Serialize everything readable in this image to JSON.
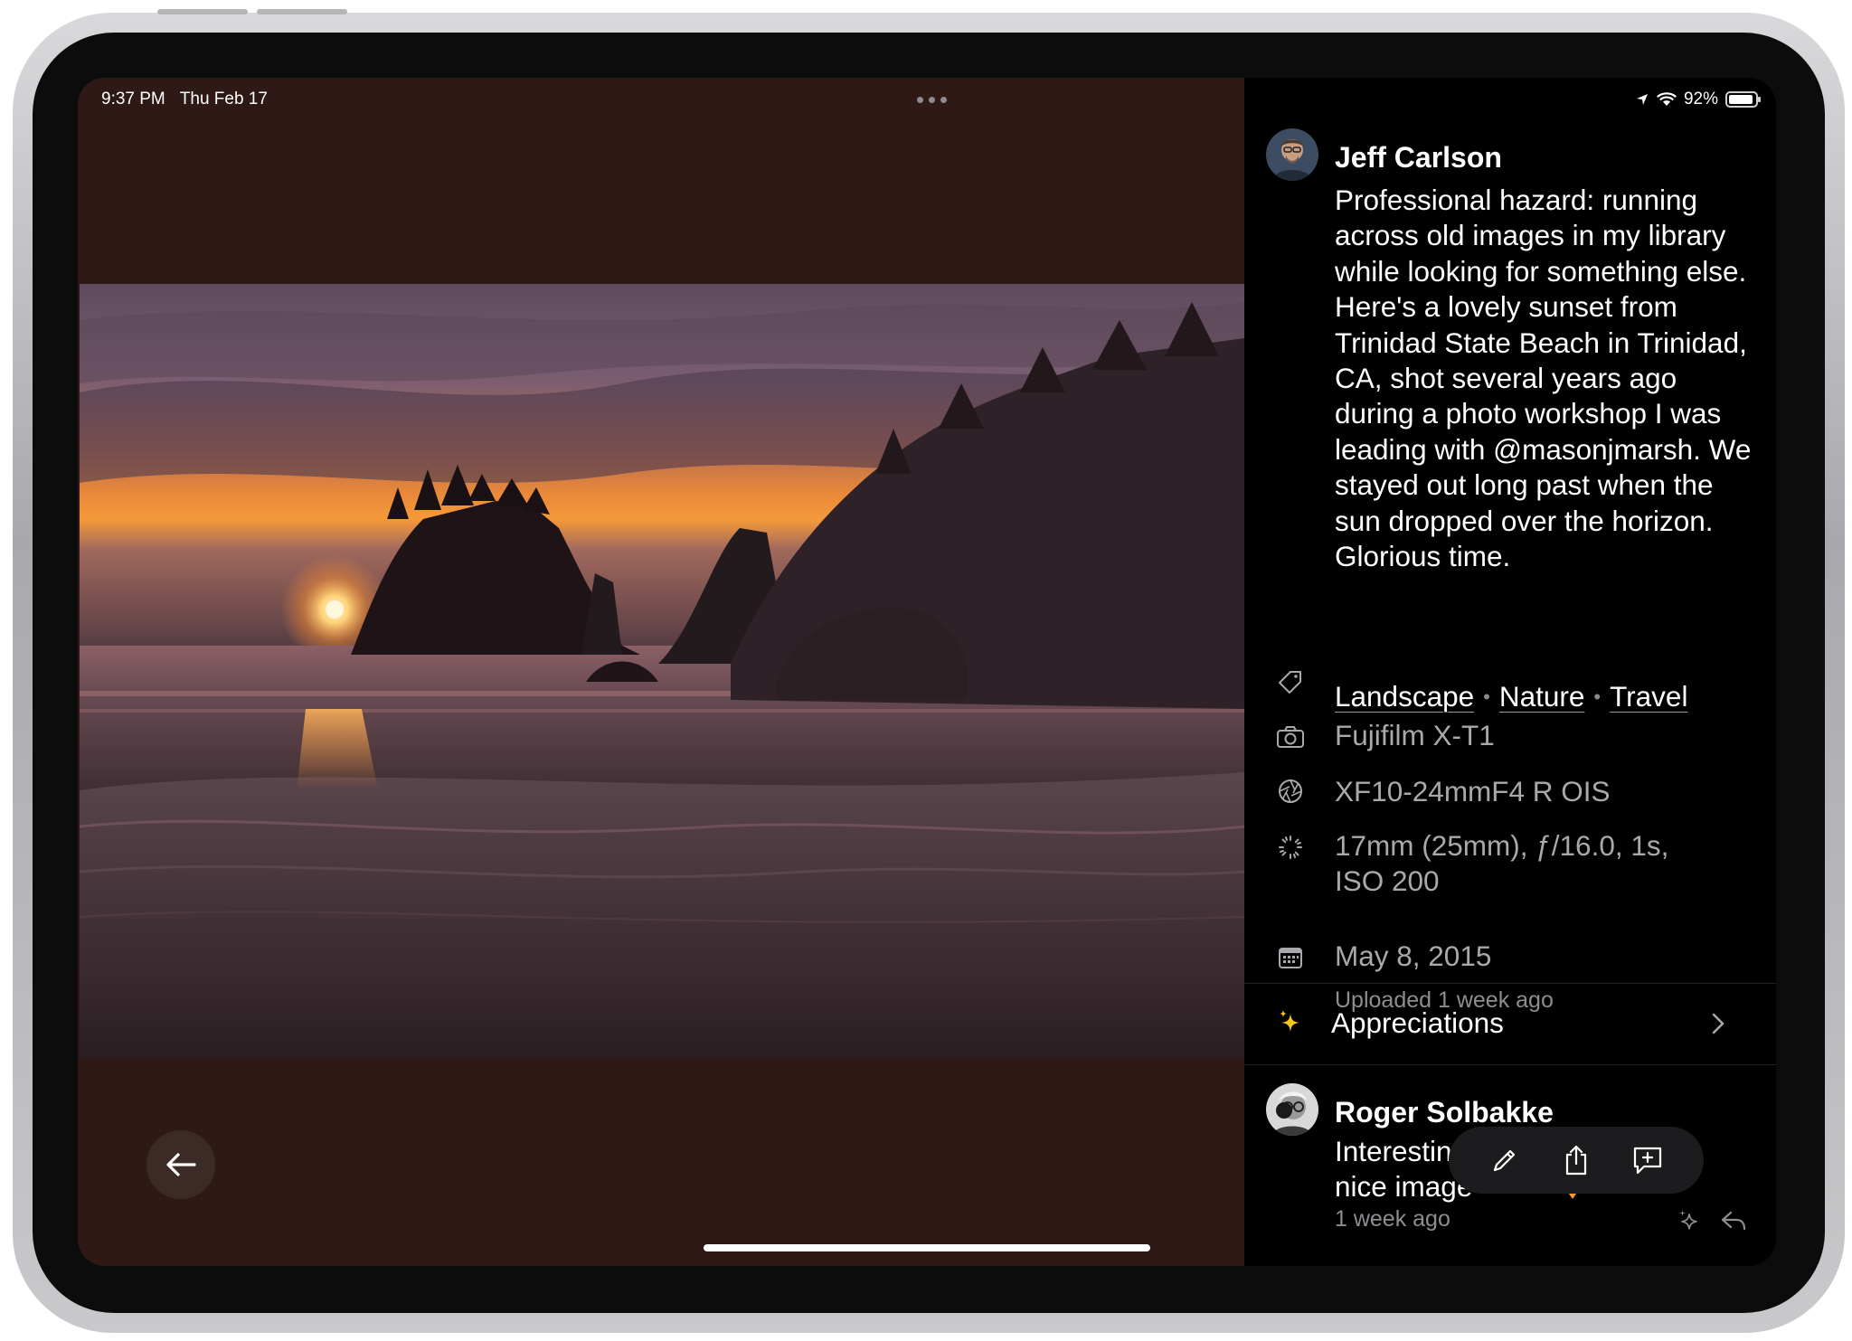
{
  "status_bar": {
    "time": "9:37 PM",
    "date": "Thu Feb 17",
    "battery": "92%"
  },
  "author": {
    "name": "Jeff Carlson",
    "caption": "Professional hazard: running across old images in my library while looking for something else. Here's a lovely sunset from Trinidad State Beach in Trinidad, CA, shot several years ago during a photo workshop I was leading with @masonjmarsh. We stayed out long past when the sun dropped over the horizon. Glorious time."
  },
  "tags": [
    "Landscape",
    "Nature",
    "Travel"
  ],
  "tag_separator": "•",
  "metadata": {
    "camera": "Fujifilm X-T1",
    "lens": "XF10-24mmF4 R OIS",
    "exposure": "17mm (25mm), ƒ/16.0, 1s, ISO 200",
    "date_taken": "May 8, 2015",
    "uploaded": "Uploaded 1 week ago"
  },
  "appreciations": {
    "label": "Appreciations"
  },
  "comment": {
    "author": "Roger Solbakke",
    "text": "Interestin",
    "text_line2": "nice image",
    "time": "1 week ago"
  },
  "icons": {
    "back": "arrow-left-icon",
    "tag": "tag-icon",
    "camera": "camera-icon",
    "lens": "aperture-icon",
    "exposure": "shutter-icon",
    "date": "calendar-icon",
    "sparkle": "sparkle-icon",
    "chevron": "chevron-right-icon",
    "edit": "pencil-icon",
    "share": "share-icon",
    "comment": "add-comment-icon",
    "reply": "reply-icon"
  },
  "colors": {
    "photo_background": "#2e1917",
    "panel_background": "#000000",
    "secondary_text": "#a9a9ad",
    "sparkle": "#f5c518"
  }
}
